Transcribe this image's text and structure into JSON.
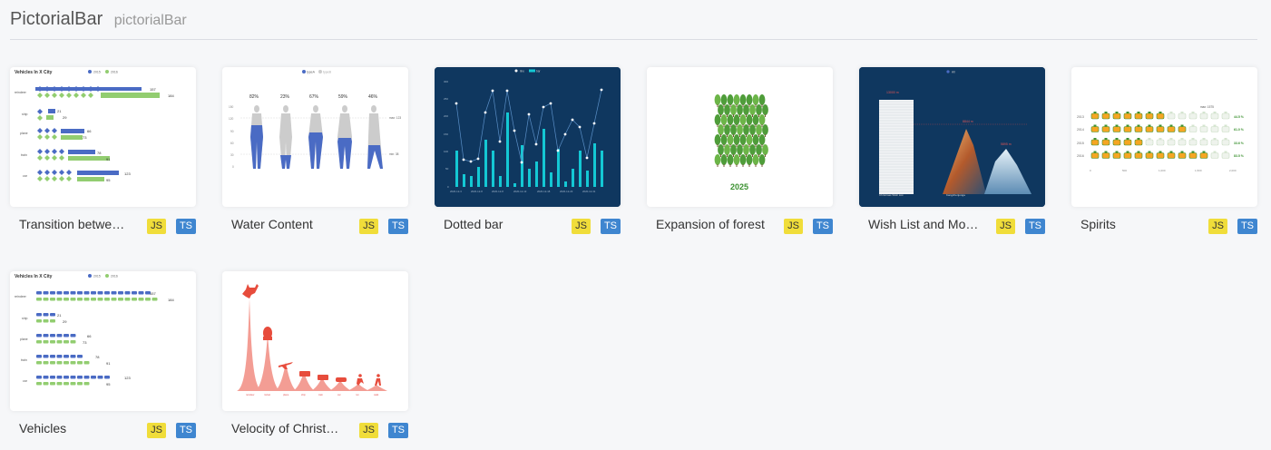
{
  "page": {
    "title": "PictorialBar",
    "subtitle": "pictorialBar"
  },
  "tags": {
    "js": "JS",
    "ts": "TS"
  },
  "cards": [
    {
      "name": "Transition betwe…",
      "thumb": {
        "title": "Vehicles In X City",
        "legend": [
          "2015",
          "2016"
        ],
        "categories": [
          "reindeer",
          "ship",
          "plane",
          "train",
          "car"
        ],
        "values_2015": [
          157,
          21,
          66,
          78,
          123
        ],
        "values_2016": [
          184,
          29,
          73,
          91,
          95
        ]
      }
    },
    {
      "name": "Water Content",
      "thumb": {
        "legend": [
          "typeA",
          "typeB"
        ],
        "percents": [
          "82%",
          "23%",
          "67%",
          "59%",
          "46%"
        ],
        "max_label": "max: 123",
        "min_label": "min: 38",
        "y_ticks": [
          "150",
          "120",
          "90",
          "60",
          "30",
          "0"
        ]
      }
    },
    {
      "name": "Dotted bar",
      "thumb": {
        "legend": [
          "line",
          "bar"
        ],
        "x_ticks": [
          "2020-12-3",
          "2020-12-8",
          "2020-12-8",
          "2020-12-13",
          "2020-12-18",
          "2020-12-23",
          "2020-12-31"
        ],
        "y_ticks": [
          "300",
          "250",
          "200",
          "150",
          "100",
          "50",
          "0"
        ]
      }
    },
    {
      "name": "Expansion of forest",
      "thumb": {
        "year": "2025"
      }
    },
    {
      "name": "Wish List and Mo…",
      "thumb": {
        "legend": [
          "All"
        ],
        "labels": [
          "Christmas Wish List",
          "Kangchenjunga",
          "Mount Everest"
        ],
        "values": [
          "13000 m",
          "8844 m",
          "5895 m"
        ]
      }
    },
    {
      "name": "Spirits",
      "thumb": {
        "max_label": "max: 1575",
        "years": [
          "2013",
          "2014",
          "2015",
          "2016"
        ],
        "percents": [
          "44.5 %",
          "61.0 %",
          "33.6 %",
          "83.5 %"
        ],
        "x_ticks": [
          "0",
          "500",
          "1,000",
          "1,500",
          "2,000"
        ]
      }
    },
    {
      "name": "Vehicles",
      "thumb": {
        "title": "Vehicles In X City",
        "legend": [
          "2015",
          "2016"
        ],
        "categories": [
          "reindeer",
          "ship",
          "plane",
          "train",
          "car"
        ],
        "values_2015": [
          157,
          21,
          66,
          78,
          123
        ],
        "values_2016": [
          184,
          29,
          73,
          91,
          95
        ]
      }
    },
    {
      "name": "Velocity of Christ…",
      "thumb": {
        "categories": [
          "reindeer",
          "rocket",
          "plane",
          "ship",
          "train",
          "car",
          "run",
          "walk"
        ]
      }
    }
  ],
  "colors": {
    "blue": "#4a6bc4",
    "green": "#92cd70",
    "navy": "#0f375f",
    "teal": "#14c8d4",
    "red": "#e74c3c",
    "forest": "#3b9130",
    "js_tag": "#f0dd3a",
    "ts_tag": "#3f86d0"
  }
}
